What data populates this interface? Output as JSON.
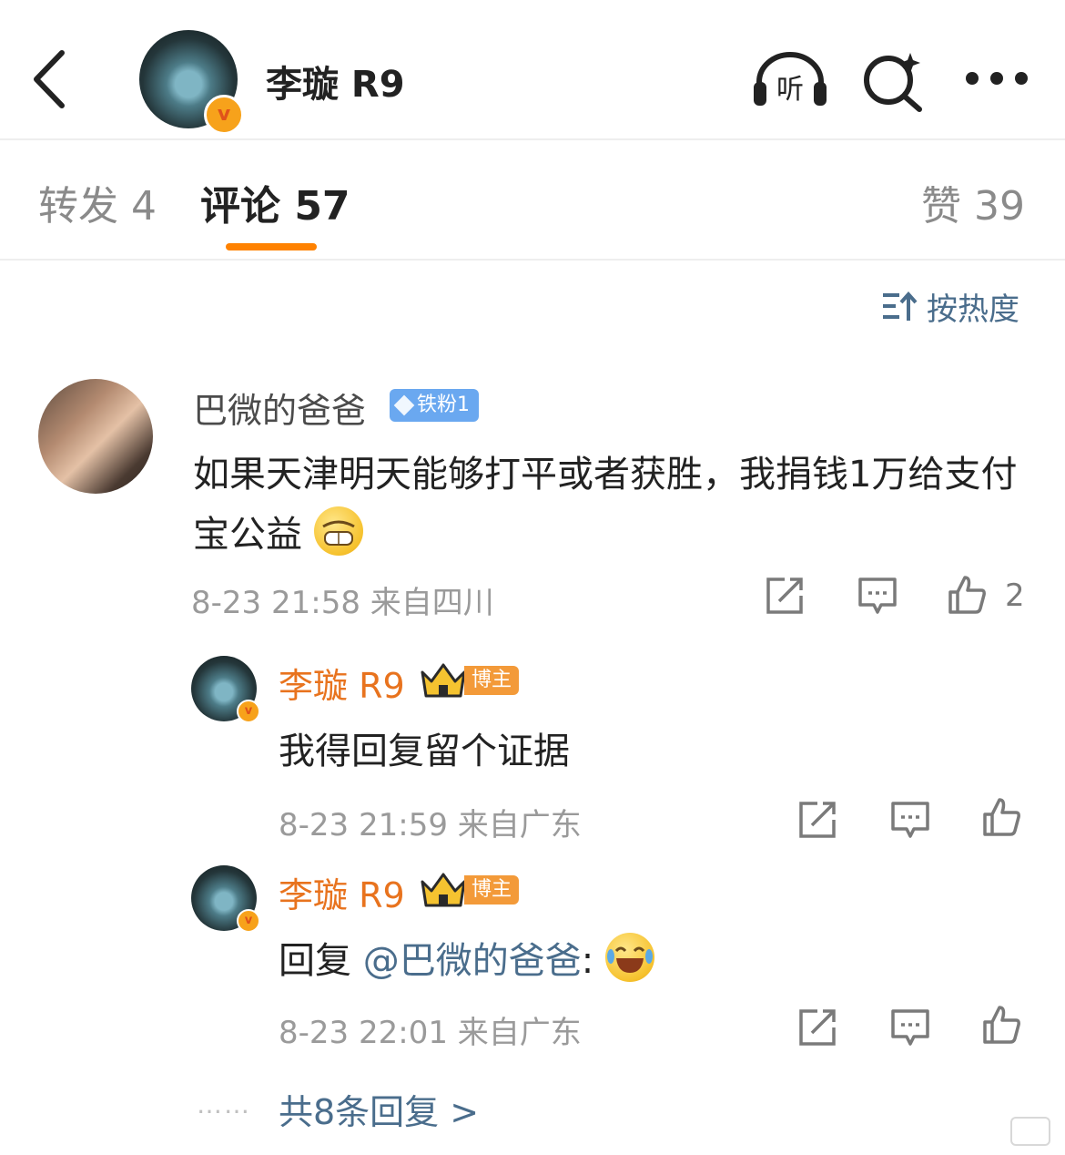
{
  "header": {
    "title": "李璇 R9",
    "listen_label": "听",
    "verified_mark": "v"
  },
  "tabs": {
    "repost": "转发 4",
    "comment": "评论 57",
    "like": "赞 39"
  },
  "sort": {
    "label": "按热度"
  },
  "comment": {
    "username": "巴微的爸爸",
    "fan_badge": "铁粉1",
    "text": "如果天津明天能够打平或者获胜，我捐钱1万给支付宝公益",
    "time": "8-23 21:58",
    "location": "来自四川",
    "like_count": "2"
  },
  "replies": [
    {
      "username": "李璇 R9",
      "role_badge": "博主",
      "text": "我得回复留个证据",
      "time": "8-23 21:59",
      "location": "来自广东"
    },
    {
      "username": "李璇 R9",
      "role_badge": "博主",
      "prefix": "回复 ",
      "mention": "@巴微的爸爸",
      "suffix": ":",
      "time": "8-23 22:01",
      "location": "来自广东"
    }
  ],
  "more_replies": {
    "dots": "……",
    "label": "共8条回复 >"
  },
  "icons": {
    "back": "chevron-left-icon",
    "listen": "headphones-icon",
    "search": "search-sparkle-icon",
    "more": "ellipsis-icon",
    "sort": "sort-icon",
    "share": "share-icon",
    "reply": "comment-icon",
    "like": "thumbs-up-icon"
  },
  "colors": {
    "accent": "#ff8200",
    "link": "#4a6d8c",
    "blogger_name": "#e8731e",
    "fan_badge": "#6aa8f0"
  }
}
